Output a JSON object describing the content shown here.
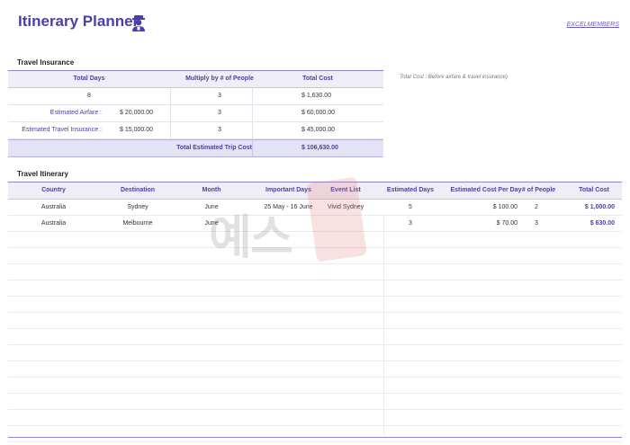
{
  "header": {
    "title": "Itinerary Planner",
    "brand_link": "EXCELMEMBERS",
    "icon": "traveler-icon"
  },
  "insurance": {
    "section_title": "Travel Insurance",
    "note": "Total Cost : Before airfare & travel insurance)",
    "headers": {
      "days": "Total Days",
      "multiply": "Multiply by # of People",
      "cost": "Total Cost"
    },
    "days_row": {
      "days": "8",
      "multiply": "3",
      "cost": "$ 1,630.00"
    },
    "airfare_row": {
      "label": "Estimated Airfare :",
      "amount": "$ 20,000.00",
      "multiply": "3",
      "cost": "$ 60,000.00"
    },
    "insurance_row": {
      "label": "Estimated Travel Insurance :",
      "amount": "$ 15,000.00",
      "multiply": "3",
      "cost": "$ 45,000.00"
    },
    "total_row": {
      "label": "Total Estimated Trip Cost",
      "cost": "$ 106,630.00"
    }
  },
  "itinerary": {
    "section_title": "Travel Itinerary",
    "columns": {
      "country": "Country",
      "destination": "Destination",
      "month": "Month",
      "important_days": "Important Days",
      "event_list": "Event List",
      "estimated_days": "Estimated Days",
      "estimated_cost": "Estimated Cost Per Day",
      "people": "# of People",
      "total_cost": "Total Cost"
    },
    "rows": [
      {
        "country": "Australia",
        "destination": "Sydney",
        "month": "June",
        "important_days": "25 May - 16 June",
        "event_list": "Vivid Sydney",
        "estimated_days": "5",
        "estimated_cost": "$ 100.00",
        "people": "2",
        "total_cost": "$ 1,000.00"
      },
      {
        "country": "Australia",
        "destination": "Melbourne",
        "month": "June",
        "important_days": "",
        "event_list": "",
        "estimated_days": "3",
        "estimated_cost": "$ 70.00",
        "people": "3",
        "total_cost": "$ 630.00"
      }
    ]
  },
  "watermark": {
    "text": "예스"
  },
  "colors": {
    "accent": "#4a3fa6",
    "header_bg": "#efeef7",
    "total_bg": "#e4e2f5"
  }
}
